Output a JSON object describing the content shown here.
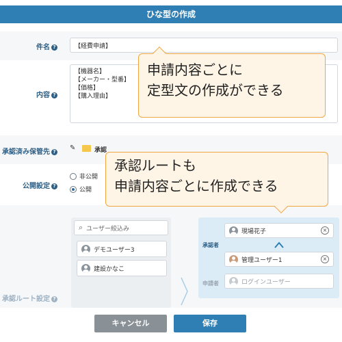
{
  "dialog": {
    "title": "ひな型の作成"
  },
  "form": {
    "subject": {
      "label": "件名",
      "value": "【経費申請】"
    },
    "content": {
      "label": "内容",
      "lines": [
        "【機器名】",
        "【メーカー・型番】",
        "【価格】",
        "【購入理由】"
      ]
    },
    "destination": {
      "label": "承認済み保管先",
      "value": "承認"
    },
    "visibility": {
      "label": "公開設定",
      "options": [
        "非公開",
        "公開"
      ],
      "selected": "公開"
    },
    "route": {
      "label": "承認ルート設定"
    }
  },
  "callouts": {
    "content_tip": {
      "line1": "申請内容ごとに",
      "line2": "定型文の作成ができる"
    },
    "route_tip": {
      "line1": "承認ルートも",
      "line2": "申請内容ごとに作成できる"
    }
  },
  "user_picker": {
    "search_placeholder": "ユーザー絞込み",
    "users": [
      "デモユーザー3",
      "建設かなこ"
    ]
  },
  "approval_flow": {
    "approver_label": "承認者",
    "approvers": [
      "現場花子",
      "管理ユーザー1"
    ],
    "applicant_label": "申請者",
    "applicant": "ログインユーザー"
  },
  "buttons": {
    "cancel": "キャンセル",
    "save": "保存"
  },
  "colors": {
    "header": "#2f7fb5",
    "label": "#2d5f86",
    "callout_border": "#f0a640",
    "cancel_button": "#8a9196",
    "save_button": "#2f7fb5"
  }
}
